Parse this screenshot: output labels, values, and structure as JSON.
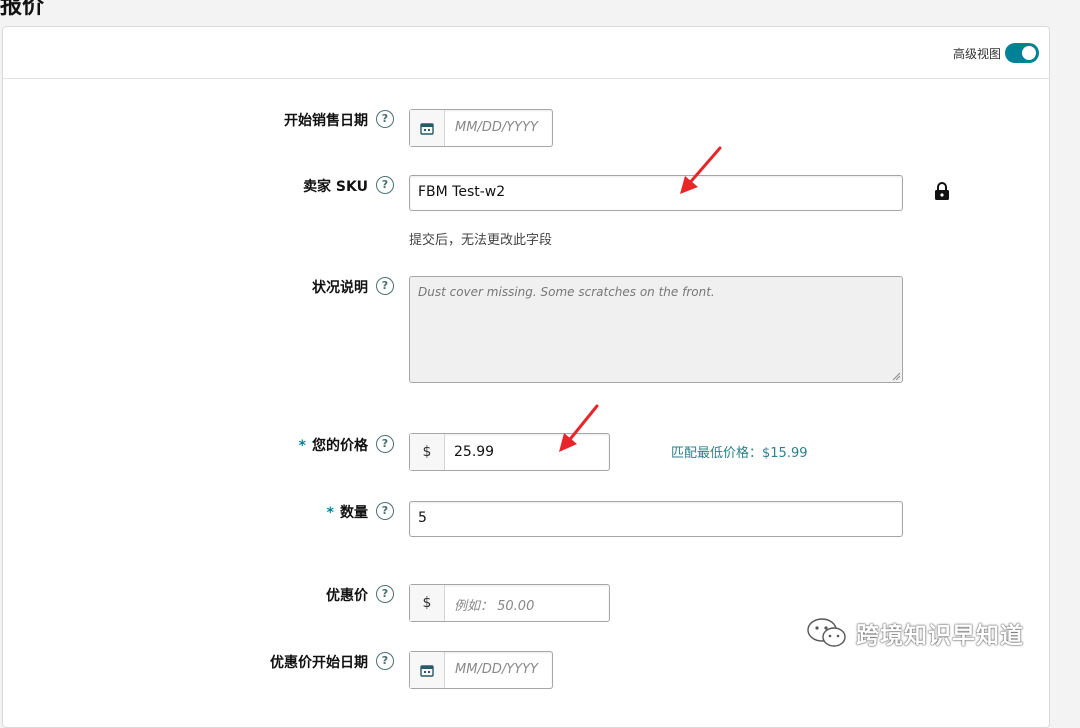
{
  "page": {
    "section_title_partial": "报价"
  },
  "header": {
    "advanced_view_label": "高级视图",
    "advanced_view_on": true
  },
  "fields": {
    "start_date": {
      "label": "开始销售日期",
      "placeholder": "MM/DD/YYYY"
    },
    "seller_sku": {
      "label": "卖家 SKU",
      "value": "FBM Test-w2",
      "hint": "提交后，无法更改此字段"
    },
    "condition_note": {
      "label": "状况说明",
      "placeholder": "Dust cover missing. Some scratches on the front."
    },
    "your_price": {
      "label": "您的价格",
      "required_mark": "*",
      "currency": "$",
      "value": "25.99",
      "match_low": "匹配最低价格：$15.99"
    },
    "quantity": {
      "label": "数量",
      "required_mark": "*",
      "value": "5"
    },
    "sale_price": {
      "label": "优惠价",
      "currency": "$",
      "placeholder": "例如： 50.00"
    },
    "sale_start_date": {
      "label": "优惠价开始日期",
      "placeholder": "MM/DD/YYYY"
    }
  },
  "help_glyph": "?",
  "watermark": {
    "text": "跨境知识早知道"
  },
  "colors": {
    "accent": "#008296",
    "arrow": "#e8262a",
    "link": "#2d7f8c"
  },
  "icons": [
    "calendar-icon",
    "help-icon",
    "lock-icon",
    "resize-grip-icon",
    "wechat-icon",
    "red-arrow-annotation"
  ]
}
